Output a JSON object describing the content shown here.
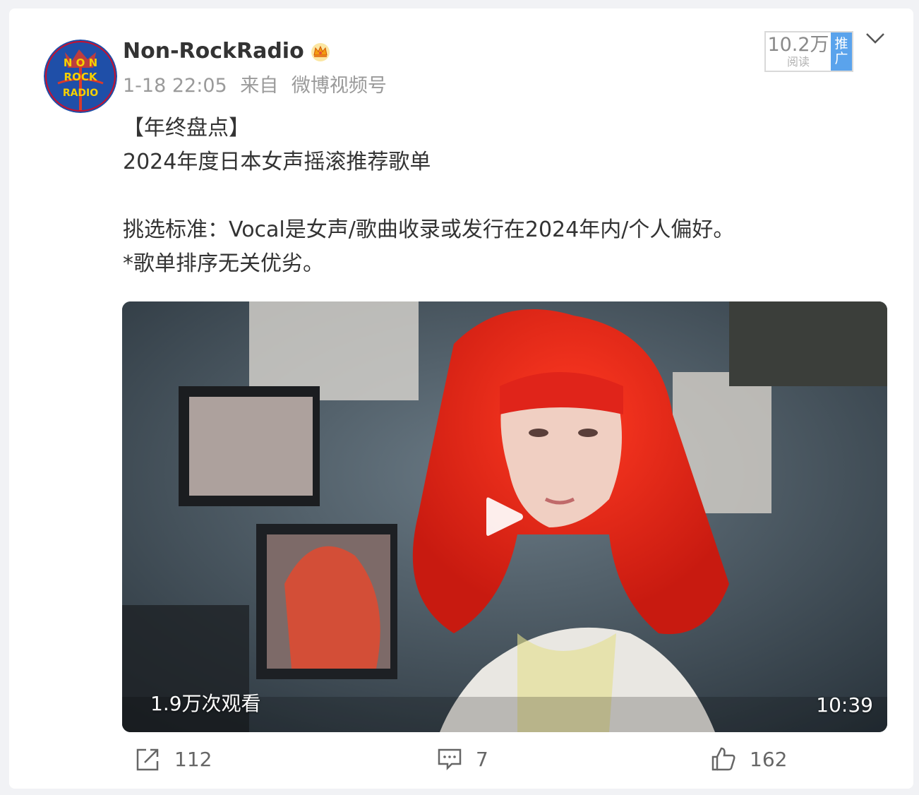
{
  "author": {
    "name": "Non-RockRadio",
    "avatar_text": "NON ROCK RADIO",
    "badge_icon": "crown-icon"
  },
  "meta": {
    "time": "1-18 22:05",
    "from_label": "来自",
    "source": "微博视频号"
  },
  "reads": {
    "count": "10.2万",
    "label": "阅读",
    "promo_line1": "推",
    "promo_line2": "广"
  },
  "post": {
    "lines": [
      "【年终盘点】",
      "2024年度日本女声摇滚推荐歌单",
      "",
      "挑选标准：Vocal是女声/歌曲收录或发行在2024年内/个人偏好。",
      "*歌单排序无关优劣。"
    ]
  },
  "video": {
    "views": "1.9万次观看",
    "duration": "10:39"
  },
  "actions": {
    "share_count": "112",
    "comment_count": "7",
    "like_count": "162"
  },
  "colors": {
    "hair": "#e8281c",
    "promo": "#5aa3ec",
    "page_bg": "#f1f2f5"
  }
}
